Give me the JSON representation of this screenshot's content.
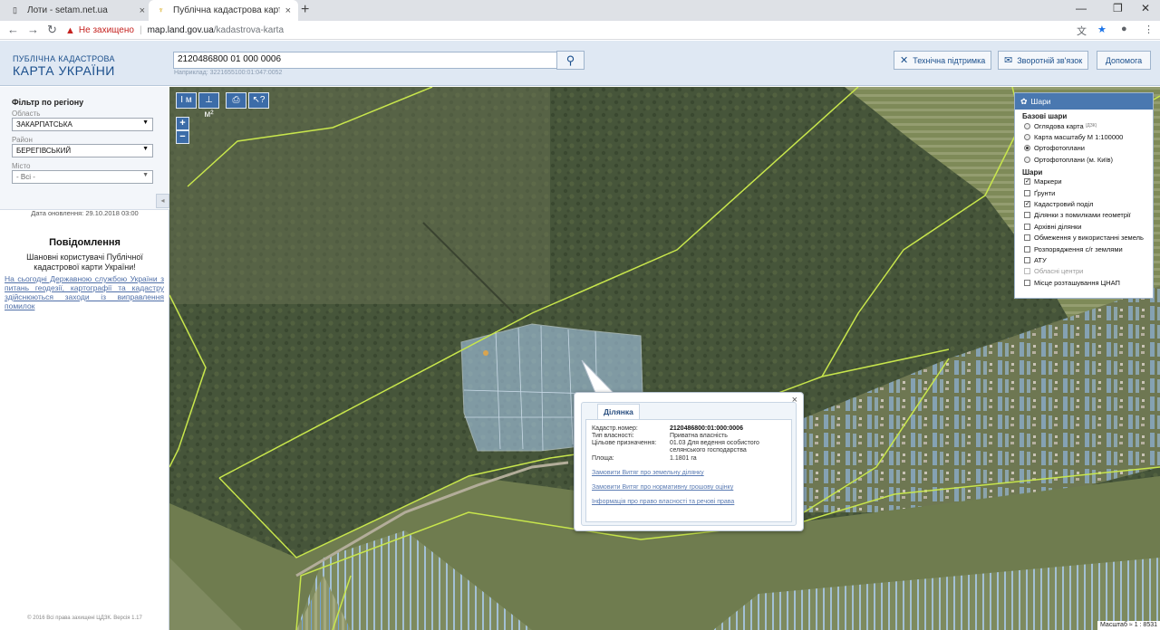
{
  "browser": {
    "tabs": [
      {
        "title": "Лоти - setam.net.ua",
        "close": "×"
      },
      {
        "title": "Публічна кадастрова карта Украї",
        "close": "×"
      }
    ],
    "new_tab": "+",
    "insecure_label": "Не захищено",
    "url_host": "map.land.gov.ua",
    "url_path": "/kadastrova-karta"
  },
  "header": {
    "logo_line1": "ПУБЛІЧНА КАДАСТРОВА",
    "logo_line2": "КАРТА УКРАЇНИ",
    "search_value": "2120486800 01 000 0006",
    "example": "Наприклад: 3221655100:01:047:0052",
    "buttons": {
      "support": "Технічна підтримка",
      "feedback": "Зворотній зв'язок",
      "help": "Допомога"
    }
  },
  "filter": {
    "title": "Фільтр по регіону",
    "oblast_label": "Область",
    "oblast_value": "ЗАКАРПАТСЬКА",
    "raion_label": "Район",
    "raion_value": "БЕРЕГІВСЬКИЙ",
    "misto_label": "Місто",
    "misto_value": "- Всі -"
  },
  "updated": "Дата оновлення: 29.10.2018 03:00",
  "notice": {
    "title": "Повідомлення",
    "greeting": "Шановні користувачі Публічної кадастрової карти України!",
    "link": "На сьогодні Державною службою України з питань геодезії, картографії та кадастру здійснюються заходи із виправлення помилок"
  },
  "copyright": "© 2016 Всі права захищені ЦДЗК. Версія 1.17",
  "layers": {
    "title": "Шари",
    "base_title": "Базові шари",
    "base": [
      {
        "label": "Оглядова карта",
        "sup": "(ДЗК)",
        "on": false
      },
      {
        "label": "Карта масштабу М 1:100000",
        "on": false
      },
      {
        "label": "Ортофотоплани",
        "on": true
      },
      {
        "label": "Ортофотоплани (м. Київ)",
        "on": false
      }
    ],
    "overlay_title": "Шари",
    "overlays": [
      {
        "label": "Маркери",
        "on": true,
        "dim": false
      },
      {
        "label": "Ґрунти",
        "on": false,
        "dim": false
      },
      {
        "label": "Кадастровий поділ",
        "on": true,
        "dim": false
      },
      {
        "label": "Ділянки з помилками геометрії",
        "on": false,
        "dim": false
      },
      {
        "label": "Архівні ділянки",
        "on": false,
        "dim": false
      },
      {
        "label": "Обмеження у використанні земель",
        "on": false,
        "dim": false
      },
      {
        "label": "Розпорядження с/г землями",
        "on": false,
        "dim": false
      },
      {
        "label": "АТУ",
        "on": false,
        "dim": false
      },
      {
        "label": "Обласні центри",
        "on": false,
        "dim": true
      },
      {
        "label": "Місце розташування ЦНАП",
        "on": false,
        "dim": false
      }
    ]
  },
  "popup": {
    "tab": "Ділянка",
    "close": "×",
    "cad_label": "Кадастр.номер:",
    "cad_value": "2120486800:01:000:0006",
    "owner_label": "Тип власності:",
    "owner_value": "Приватна власність",
    "purpose_label": "Цільове призначення:",
    "purpose_value": "01.03 Для ведення особистого селянського господарства",
    "area_label": "Площа:",
    "area_value": "1.1801 га",
    "link1": "Замовити Витяг про земельну ділянку",
    "link2": "Замовити Витяг про нормативну грошову оцінку",
    "link3": "Інформація про право власності та речові права"
  },
  "map_tools": [
    "I м",
    "⊥ м²",
    "⎙",
    "↖?"
  ],
  "zoom": {
    "in": "+",
    "out": "−"
  },
  "scale": "Масштаб ≈ 1 : 8531"
}
